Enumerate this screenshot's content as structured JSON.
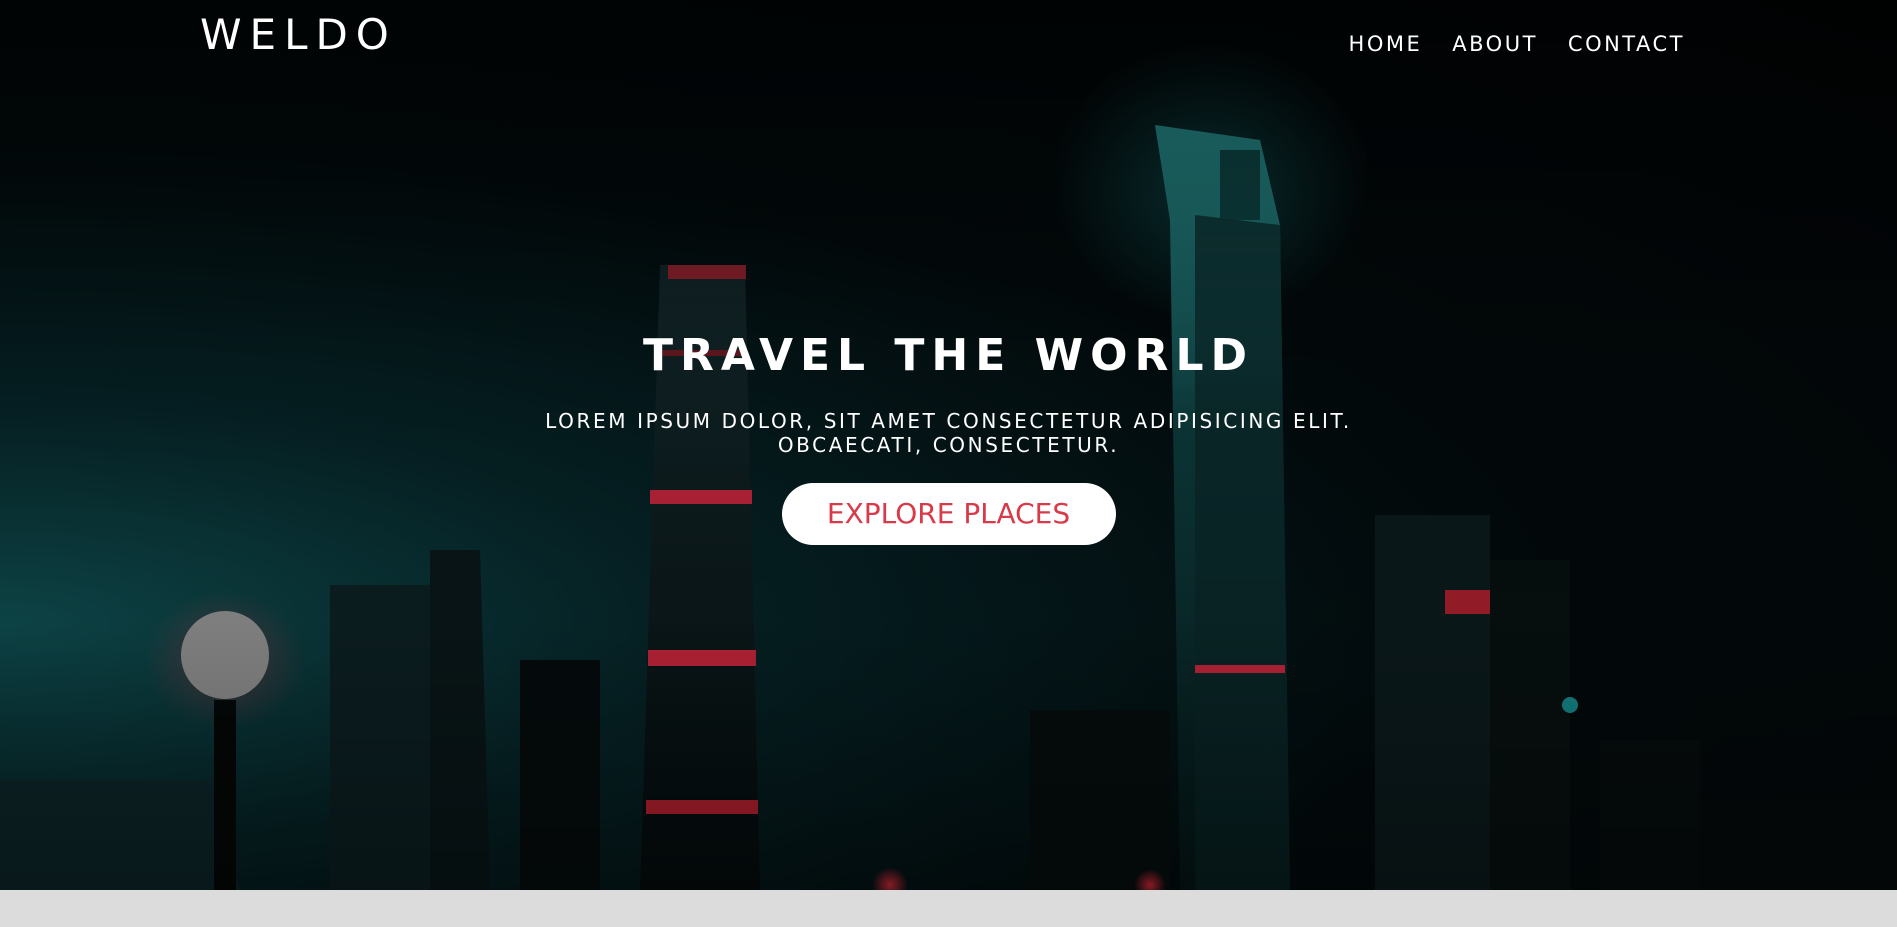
{
  "header": {
    "logo": "WELDO",
    "nav": [
      {
        "label": "HOME"
      },
      {
        "label": "ABOUT"
      },
      {
        "label": "CONTACT"
      }
    ]
  },
  "hero": {
    "title": "TRAVEL THE WORLD",
    "subtitle_line1": "LOREM IPSUM DOLOR, SIT AMET CONSECTETUR ADIPISICING ELIT.",
    "subtitle_line2": "OBCAECATI, CONSECTETUR.",
    "cta_label": "EXPLORE PLACES"
  },
  "colors": {
    "accent": "#d93a4a",
    "button_bg": "#ffffff",
    "footer_strip": "#dcdcdc"
  }
}
